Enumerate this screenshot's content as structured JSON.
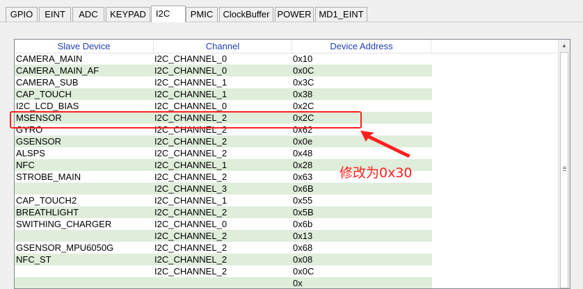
{
  "tabs": [
    {
      "label": "GPIO",
      "active": false
    },
    {
      "label": "EINT",
      "active": false
    },
    {
      "label": "ADC",
      "active": false
    },
    {
      "label": "KEYPAD",
      "active": false
    },
    {
      "label": "I2C",
      "active": true
    },
    {
      "label": "PMIC",
      "active": false
    },
    {
      "label": "ClockBuffer",
      "active": false
    },
    {
      "label": "POWER",
      "active": false
    },
    {
      "label": "MD1_EINT",
      "active": false
    }
  ],
  "table": {
    "columns": [
      "Slave Device",
      "Channel",
      "Device Address"
    ],
    "rows": [
      [
        "CAMERA_MAIN",
        "I2C_CHANNEL_0",
        "0x10"
      ],
      [
        "CAMERA_MAIN_AF",
        "I2C_CHANNEL_0",
        "0x0C"
      ],
      [
        "CAMERA_SUB",
        "I2C_CHANNEL_1",
        "0x3C"
      ],
      [
        "CAP_TOUCH",
        "I2C_CHANNEL_1",
        "0x38"
      ],
      [
        "I2C_LCD_BIAS",
        "I2C_CHANNEL_0",
        "0x2C"
      ],
      [
        "MSENSOR",
        "I2C_CHANNEL_2",
        "0x2C"
      ],
      [
        "GYRO",
        "I2C_CHANNEL_2",
        "0x62"
      ],
      [
        "GSENSOR",
        "I2C_CHANNEL_2",
        "0x0e"
      ],
      [
        "ALSPS",
        "I2C_CHANNEL_2",
        "0x48"
      ],
      [
        "NFC",
        "I2C_CHANNEL_1",
        "0x28"
      ],
      [
        "STROBE_MAIN",
        "I2C_CHANNEL_2",
        "0x63"
      ],
      [
        "",
        "I2C_CHANNEL_3",
        "0x6B"
      ],
      [
        "CAP_TOUCH2",
        "I2C_CHANNEL_1",
        "0x55"
      ],
      [
        "BREATHLIGHT",
        "I2C_CHANNEL_2",
        "0x5B"
      ],
      [
        "SWITHING_CHARGER",
        "I2C_CHANNEL_0",
        "0x6b"
      ],
      [
        "",
        "I2C_CHANNEL_2",
        "0x13"
      ],
      [
        "GSENSOR_MPU6050G",
        "I2C_CHANNEL_2",
        "0x68"
      ],
      [
        "NFC_ST",
        "I2C_CHANNEL_2",
        "0x08"
      ],
      [
        "",
        "I2C_CHANNEL_2",
        "0x0C"
      ],
      [
        "",
        "",
        "0x"
      ]
    ],
    "highlighted_row": "MSENSOR"
  },
  "annotation": {
    "text": "修改为0x30",
    "color": "#ff2020"
  },
  "colors": {
    "header_text": "#1f3fb5",
    "alt_row": "#dfeedb"
  }
}
